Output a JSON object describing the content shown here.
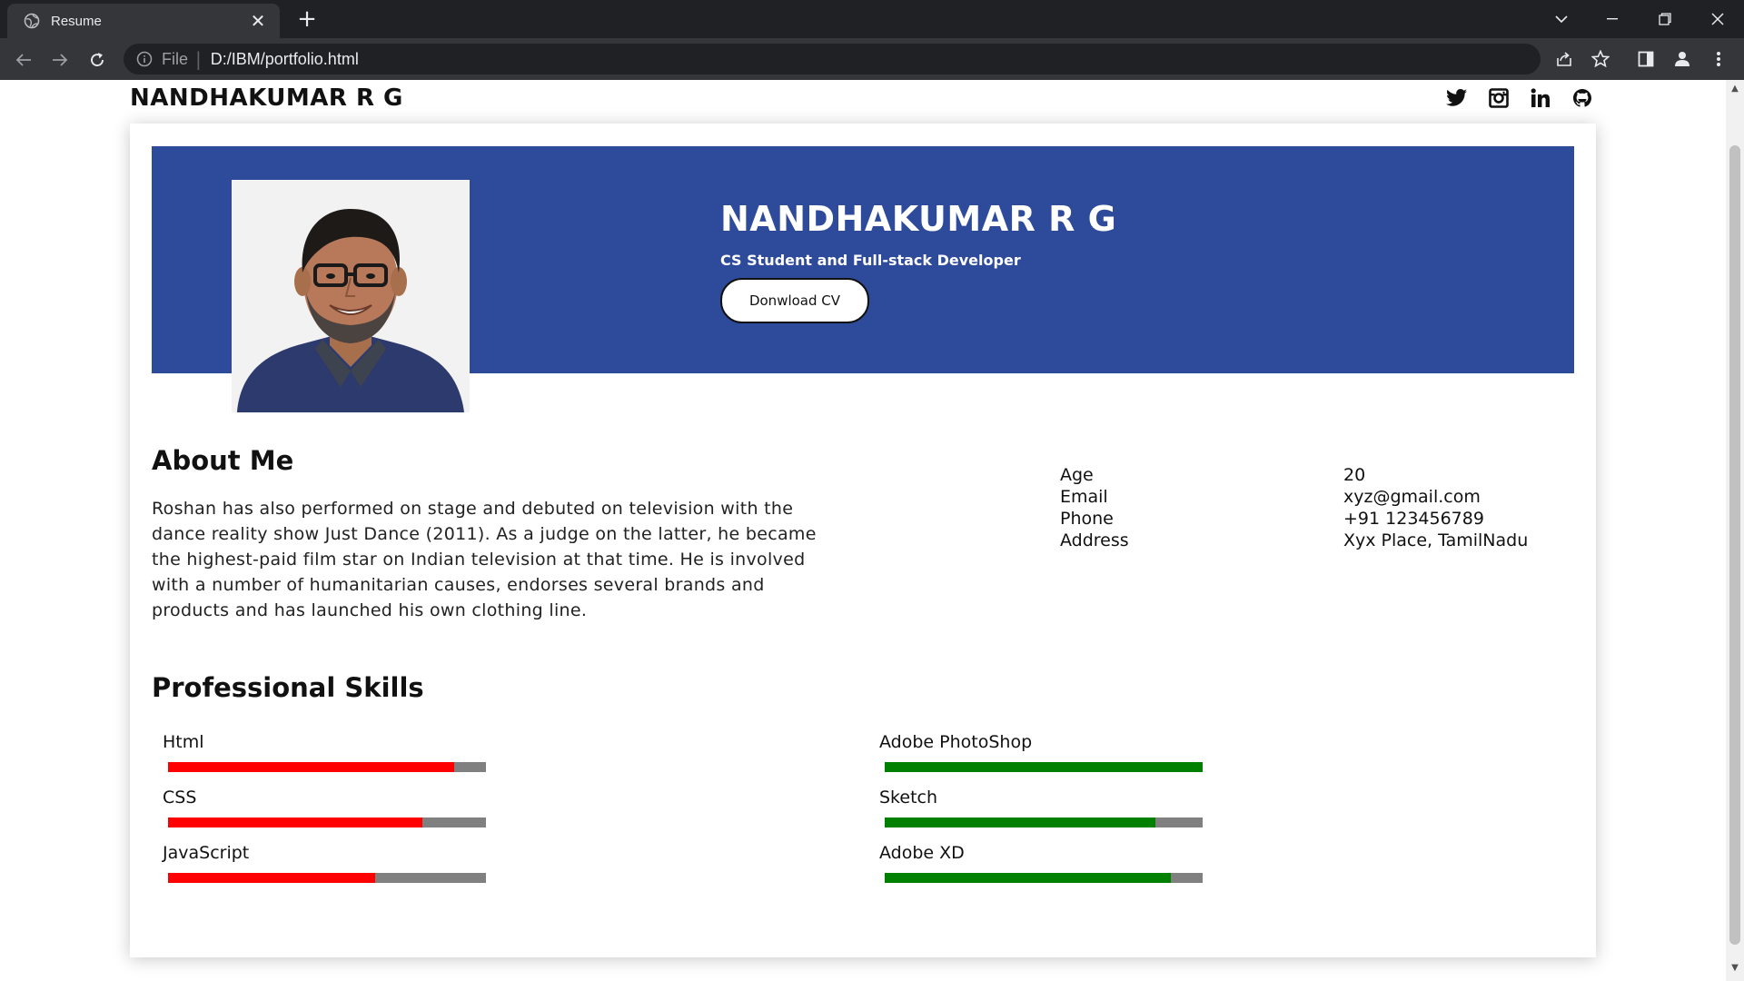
{
  "browser": {
    "tab_title": "Resume",
    "omnibox_scheme": "File",
    "url": "D:/IBM/portfolio.html"
  },
  "nav": {
    "brand": "NANDHAKUMAR R G",
    "socials": [
      "twitter-icon",
      "instagram-icon",
      "linkedin-icon",
      "github-icon"
    ]
  },
  "hero": {
    "name": "NANDHAKUMAR R G",
    "subtitle": "CS Student and Full-stack Developer",
    "cv_button": "Donwload CV",
    "background_color": "#2e4a9b"
  },
  "about": {
    "title": "About Me",
    "text": "Roshan has also performed on stage and debuted on television with the dance reality show Just Dance (2011). As a judge on the latter, he became the highest-paid film star on Indian television at that time. He is involved with a number of humanitarian causes, endorses several brands and products and has launched his own clothing line."
  },
  "info": [
    {
      "label": "Age",
      "value": "20"
    },
    {
      "label": "Email",
      "value": "xyz@gmail.com"
    },
    {
      "label": "Phone",
      "value": "+91 123456789"
    },
    {
      "label": "Address",
      "value": "Xyx Place, TamilNadu"
    }
  ],
  "skills": {
    "title": "Professional Skills",
    "left": [
      {
        "name": "Html",
        "level": 0.9,
        "color": "#ff0000"
      },
      {
        "name": "CSS",
        "level": 0.8,
        "color": "#ff0000"
      },
      {
        "name": "JavaScript",
        "level": 0.65,
        "color": "#ff0000"
      }
    ],
    "right": [
      {
        "name": "Adobe PhotoShop",
        "level": 1.0,
        "color": "#008000"
      },
      {
        "name": "Sketch",
        "level": 0.85,
        "color": "#008000"
      },
      {
        "name": "Adobe XD",
        "level": 0.9,
        "color": "#008000"
      }
    ]
  }
}
